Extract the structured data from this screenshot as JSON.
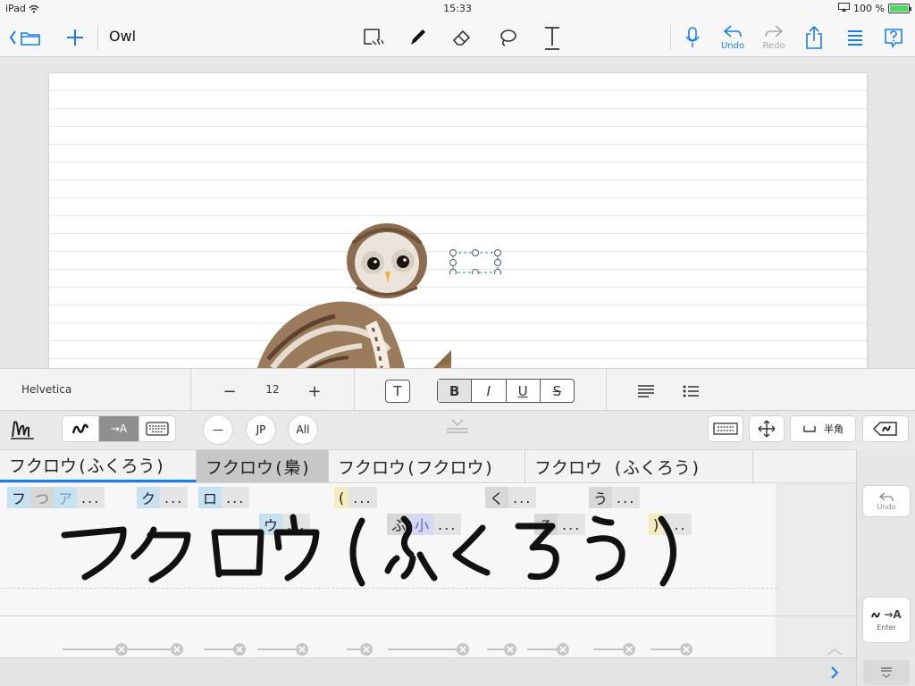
{
  "status": {
    "device": "iPad",
    "time": "15:33",
    "battery": "100 %"
  },
  "toolbar": {
    "title": "Owl",
    "undo_label": "Undo",
    "redo_label": "Redo"
  },
  "format": {
    "font": "Helvetica",
    "size": "12",
    "minus": "−",
    "plus": "+",
    "text_btn": "T",
    "bold": "B",
    "italic": "I",
    "underline": "U",
    "strike": "S"
  },
  "hw_toolbar": {
    "convert": "→A",
    "line": "—",
    "jp": "JP",
    "all": "All",
    "space_label": "半角"
  },
  "candidates": [
    "フクロウ(ふくろう)",
    "フクロウ(梟)",
    "フクロウ(フクロウ)",
    "フクロウ (ふくろう)"
  ],
  "chips": {
    "fu": "フ",
    "tsu": "つ",
    "a": "ア",
    "ku": "ク",
    "ro": "ロ",
    "u_kata": "ウ",
    "open_paren": "(",
    "fu_hira": "ふ",
    "small": "小",
    "ku_hira": "く",
    "ro_hira": "ろ",
    "u_hira": "う",
    "close_paren": ")",
    "dots": "..."
  },
  "side": {
    "undo": "Undo",
    "enter": "Enter",
    "convert": "→A"
  },
  "colors": {
    "accent": "#1a7ee6",
    "chip_blue": "#c6e2f2",
    "chip_yellow": "#f5ecbe"
  }
}
